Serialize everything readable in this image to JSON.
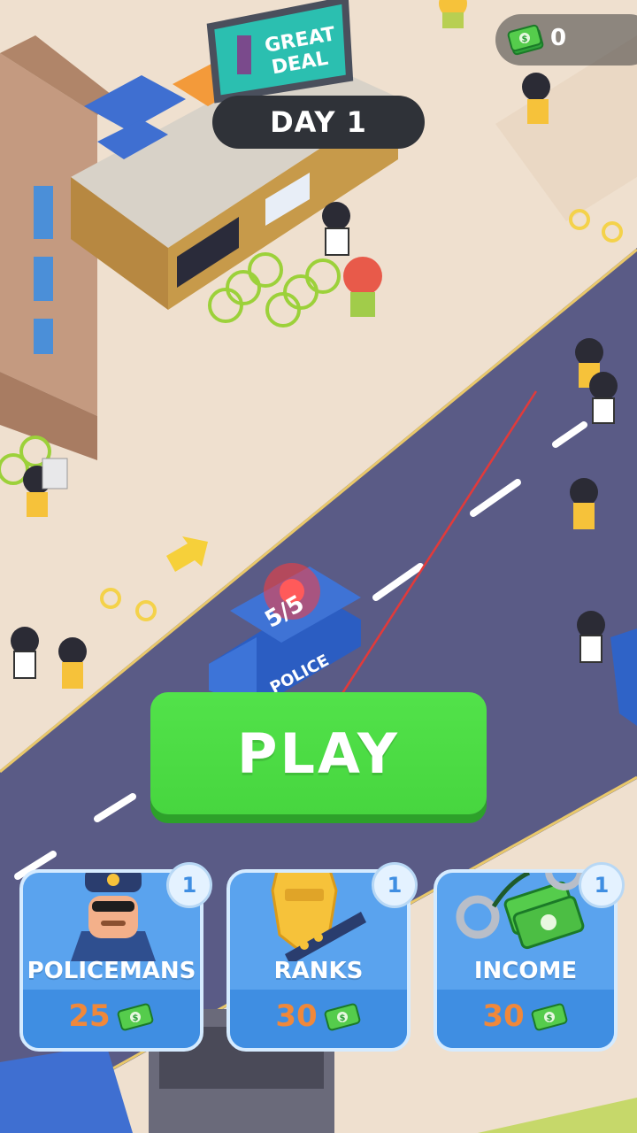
{
  "hud": {
    "cash_icon": "cash-stack-icon",
    "cash_value": "0",
    "day_label": "DAY 1"
  },
  "scene": {
    "billboard_text_line1": "GREAT",
    "billboard_text_line2": "DEAL",
    "van_label": "POLICE",
    "van_capacity": "5/5"
  },
  "play_button": {
    "label": "PLAY"
  },
  "upgrades": [
    {
      "label": "POLICEMANS",
      "price": "25",
      "level": "1",
      "icon": "policeman-icon"
    },
    {
      "label": "RANKS",
      "price": "30",
      "level": "1",
      "icon": "police-badge-icon"
    },
    {
      "label": "INCOME",
      "price": "30",
      "level": "1",
      "icon": "cash-handcuffs-icon"
    }
  ],
  "colors": {
    "road": "#5a5b86",
    "sidewalk": "#efe0cf",
    "play_green": "#4cdc44",
    "card_blue": "#5aa3ee",
    "price_orange": "#f0883a"
  }
}
